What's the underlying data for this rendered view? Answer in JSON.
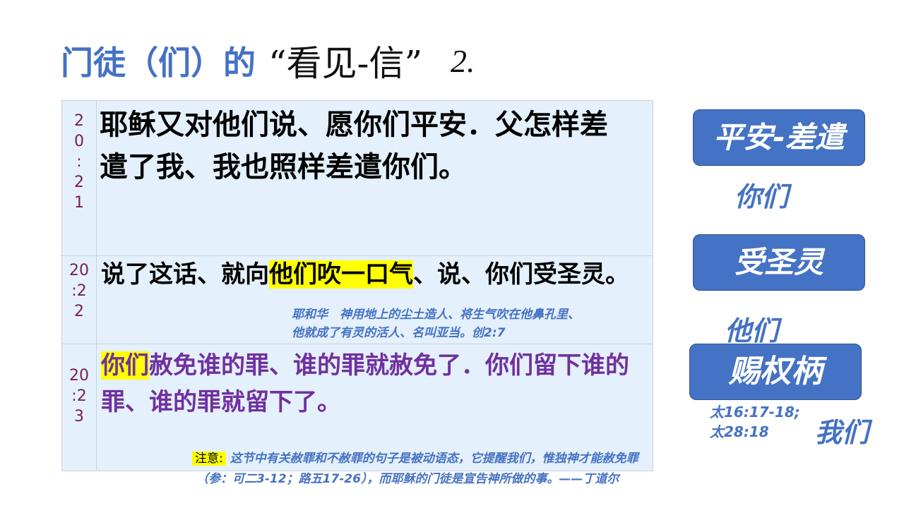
{
  "title": {
    "prefix": "门徒（们）的",
    "quote": "“看见-信”",
    "number": "2."
  },
  "verses": [
    {
      "ref": "20:21",
      "ref_lines": [
        "2",
        "0",
        ":",
        "2",
        "1"
      ],
      "text": "耶稣又对他们说、愿你们平安．父怎样差遣了我、我也照样差遣你们。"
    },
    {
      "ref": "20:22",
      "ref_lines": [
        "20",
        ":2",
        "2"
      ],
      "text_before": "说了这话、就向",
      "highlight": "他们吹一口气",
      "text_after": "、说、你们受圣灵。"
    },
    {
      "ref": "20:23",
      "ref_lines": [
        "20",
        ":2",
        "3"
      ],
      "highlight": "你们",
      "text_after": "赦免谁的罪、谁的罪就赦免了．你们留下谁的罪、谁的罪就留下了。"
    }
  ],
  "notes": {
    "genesis_line1": "耶和华　神用地上的尘土造人、将生气吹在他鼻孔里、",
    "genesis_line2": "他就成了有灵的活人、名叫亚当。创2:7",
    "attention_label": "注意:",
    "attention_line1": "这节中有关赦罪和不赦罪的句子是被动语态，它提醒我们，惟独神才能赦免罪",
    "attention_line2": "（参：可二3-12；路五17-26），而耶稣的门徒是宣告神所做的事。——丁道尔"
  },
  "side": {
    "button1": "平安-差遣",
    "label1": "你们",
    "button2": "受圣灵",
    "label2": "他们",
    "button3": "赐权柄",
    "ref_line1": "太16:17-18;",
    "ref_line2": "太28:18",
    "label3": "我们"
  },
  "colors": {
    "accent_blue": "#4472c4",
    "highlight_yellow": "#ffff00",
    "purple_text": "#7030a0",
    "verse_number": "#7a1f4a",
    "table_background": "#e4f0fb"
  }
}
